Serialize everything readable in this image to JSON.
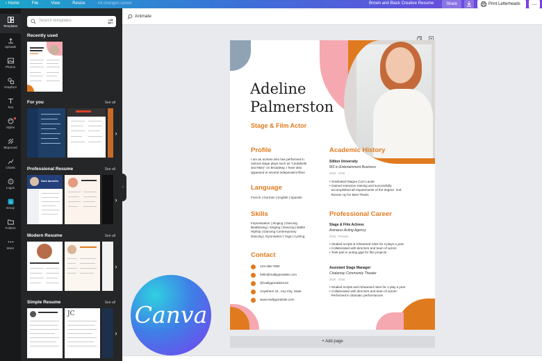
{
  "topbar": {
    "menu": [
      "Home",
      "File",
      "View",
      "Resize"
    ],
    "saved_status": "All changes saved",
    "doc_title": "Brown and Black Creative Resume",
    "share_label": "Share",
    "print_label": "Print Letterheads",
    "more_label": "..."
  },
  "rail": [
    {
      "label": "Templates",
      "icon": "templates-icon"
    },
    {
      "label": "Uploads",
      "icon": "upload-icon"
    },
    {
      "label": "Photos",
      "icon": "photo-icon"
    },
    {
      "label": "Graphics",
      "icon": "graphics-icon"
    },
    {
      "label": "Text",
      "icon": "text-icon"
    },
    {
      "label": "Styles",
      "icon": "styles-icon"
    },
    {
      "label": "Bkground",
      "icon": "background-icon"
    },
    {
      "label": "Charts",
      "icon": "chart-icon"
    },
    {
      "label": "Logos",
      "icon": "logo-icon"
    },
    {
      "label": "Emoji",
      "icon": "emoji-icon"
    },
    {
      "label": "Folders",
      "icon": "folder-icon"
    },
    {
      "label": "More",
      "icon": "more-icon"
    }
  ],
  "panel": {
    "search_placeholder": "Search templates",
    "see_all": "See all",
    "sections": [
      {
        "title": "Recently used"
      },
      {
        "title": "For you"
      },
      {
        "title": "Professional Resume"
      },
      {
        "title": "Modern Resume"
      },
      {
        "title": "Simple Resume"
      }
    ],
    "thumb_texts": {
      "pro_1": "Sara Iannello",
      "simple_1": "JC"
    }
  },
  "editor": {
    "animate_label": "Animate",
    "add_page_label": "+ Add page"
  },
  "resume": {
    "first_name": "Adeline",
    "last_name": "Palmerston",
    "role": "Stage & Film Actor",
    "profile_heading": "Profile",
    "profile_text": [
      "I am an actress who has performed in",
      "various stage plays such as \"Lindabelle",
      "and Mary\" on Broadway. I have also",
      "appeared in several independent films"
    ],
    "language_heading": "Language",
    "language_text": "French | German | English | Spanish",
    "skills_heading": "Skills",
    "skills_text": [
      "Improvisation | Singing | Dancing",
      "Beatboxing | Singing | Dancing | Ballet",
      "Hiphop | Dancing Contemporary",
      "Dancing | Gymnastics | Yoga | Cycling"
    ],
    "contact_heading": "Contact",
    "contacts": [
      "123-456-7890",
      "hello@reallygreatsite.com",
      "@reallygreatsite123",
      "Anywhere St., Any City, State",
      "www.reallygreatsite.com"
    ],
    "academic_heading": "Academic History",
    "academic": {
      "school": "Sillton University",
      "degree": "MS in Entertainment Business",
      "dates": "2015 - 2016",
      "bullets": [
        "Graduated Magna Cum Laude",
        "Gained extensive training and successfully",
        "accomplished all requirements of the degree- 2nd",
        "Runner Up for Best Thesis"
      ]
    },
    "career_heading": "Professional Career",
    "jobs": [
      {
        "title": "Stage & Film Actress",
        "company": "Astraeus Acting Agency",
        "dates": "2016 - Present",
        "bullets": [
          "Studied scripts & rehearsed roles for 3 plays a year",
          "Collaborated with directors and team of actors",
          "Took part in acting gigs for film projects"
        ]
      },
      {
        "title": "Assistant Stage Manager",
        "company": "Chalamay Community Theater",
        "dates": "2015 - 2016",
        "bullets": [
          "Studied scripts and rehearsed roles for 1 play a year",
          "Collaborated with directors and team of actors-",
          "Performed in dramatic performances"
        ]
      }
    ]
  },
  "logo": {
    "text": "Canva"
  },
  "colors": {
    "accent": "#e07a1f",
    "pink": "#f5a8b0",
    "slate": "#8fa3b5",
    "rail": "#18191b",
    "panel": "#252627"
  }
}
